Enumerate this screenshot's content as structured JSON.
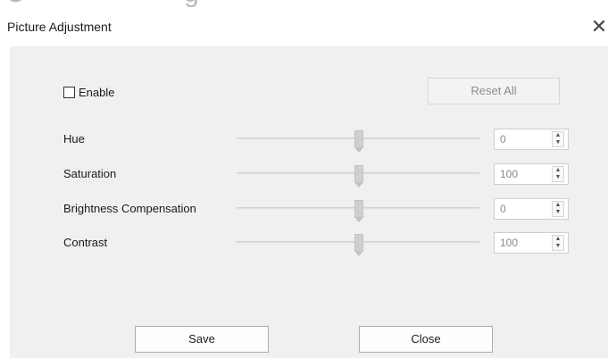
{
  "top_fragment": {
    "left": "C",
    "main": "g"
  },
  "window": {
    "title": "Picture Adjustment",
    "close_glyph": "✕"
  },
  "enable": {
    "label": "Enable",
    "checked": false
  },
  "reset_button": {
    "label": "Reset All",
    "enabled": false
  },
  "params": [
    {
      "label": "Hue",
      "value": "0",
      "slider_position": 0.5
    },
    {
      "label": "Saturation",
      "value": "100",
      "slider_position": 0.5
    },
    {
      "label": "Brightness Compensation",
      "value": "0",
      "slider_position": 0.5
    },
    {
      "label": "Contrast",
      "value": "100",
      "slider_position": 0.5
    }
  ],
  "buttons": {
    "save": "Save",
    "close": "Close"
  },
  "spin_glyphs": {
    "up": "▲",
    "down": "▼"
  }
}
